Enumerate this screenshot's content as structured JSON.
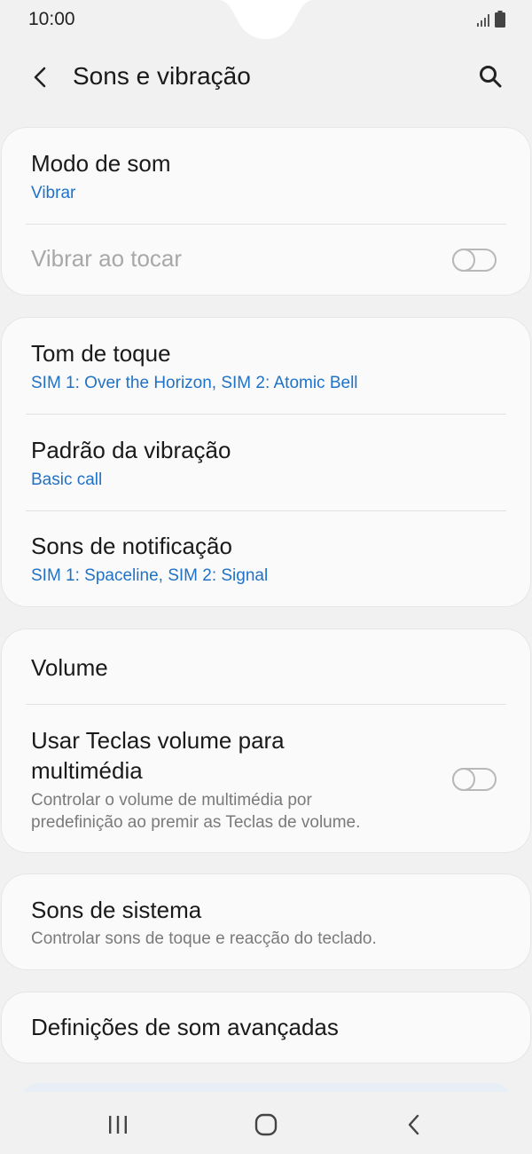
{
  "status_bar": {
    "time": "10:00"
  },
  "header": {
    "title": "Sons e vibração",
    "back_icon": "chevron-left-icon",
    "search_icon": "search-icon"
  },
  "card1": {
    "sound_mode": {
      "title": "Modo de som",
      "value": "Vibrar"
    },
    "vibrate_on_touch": {
      "title": "Vibrar ao tocar",
      "enabled": false
    }
  },
  "card2": {
    "ringtone": {
      "title": "Tom de toque",
      "value": "SIM 1: Over the Horizon, SIM 2: Atomic Bell"
    },
    "vibration_pattern": {
      "title": "Padrão da vibração",
      "value": "Basic call"
    },
    "notification_sounds": {
      "title": "Sons de notificação",
      "value": "SIM 1: Spaceline, SIM 2: Signal"
    }
  },
  "card3": {
    "volume": {
      "title": "Volume"
    },
    "volume_keys_media": {
      "title_line1": "Usar Teclas volume para",
      "title_line2": "multimédia",
      "desc_line1": "Controlar o volume de multimédia por",
      "desc_line2": "predefinição ao premir as Teclas de volume.",
      "enabled": false
    }
  },
  "card4": {
    "system_sounds": {
      "title": "Sons de sistema",
      "desc": "Controlar sons de toque e reacção do teclado."
    }
  },
  "card5": {
    "advanced_sound": {
      "title": "Definições de som avançadas"
    }
  },
  "nav": {
    "recents_icon": "recents-icon",
    "home_icon": "home-icon",
    "back_icon": "back-icon"
  },
  "colors": {
    "accent": "#1f72c7",
    "background": "#f1f1f1",
    "card": "#fafafa"
  }
}
